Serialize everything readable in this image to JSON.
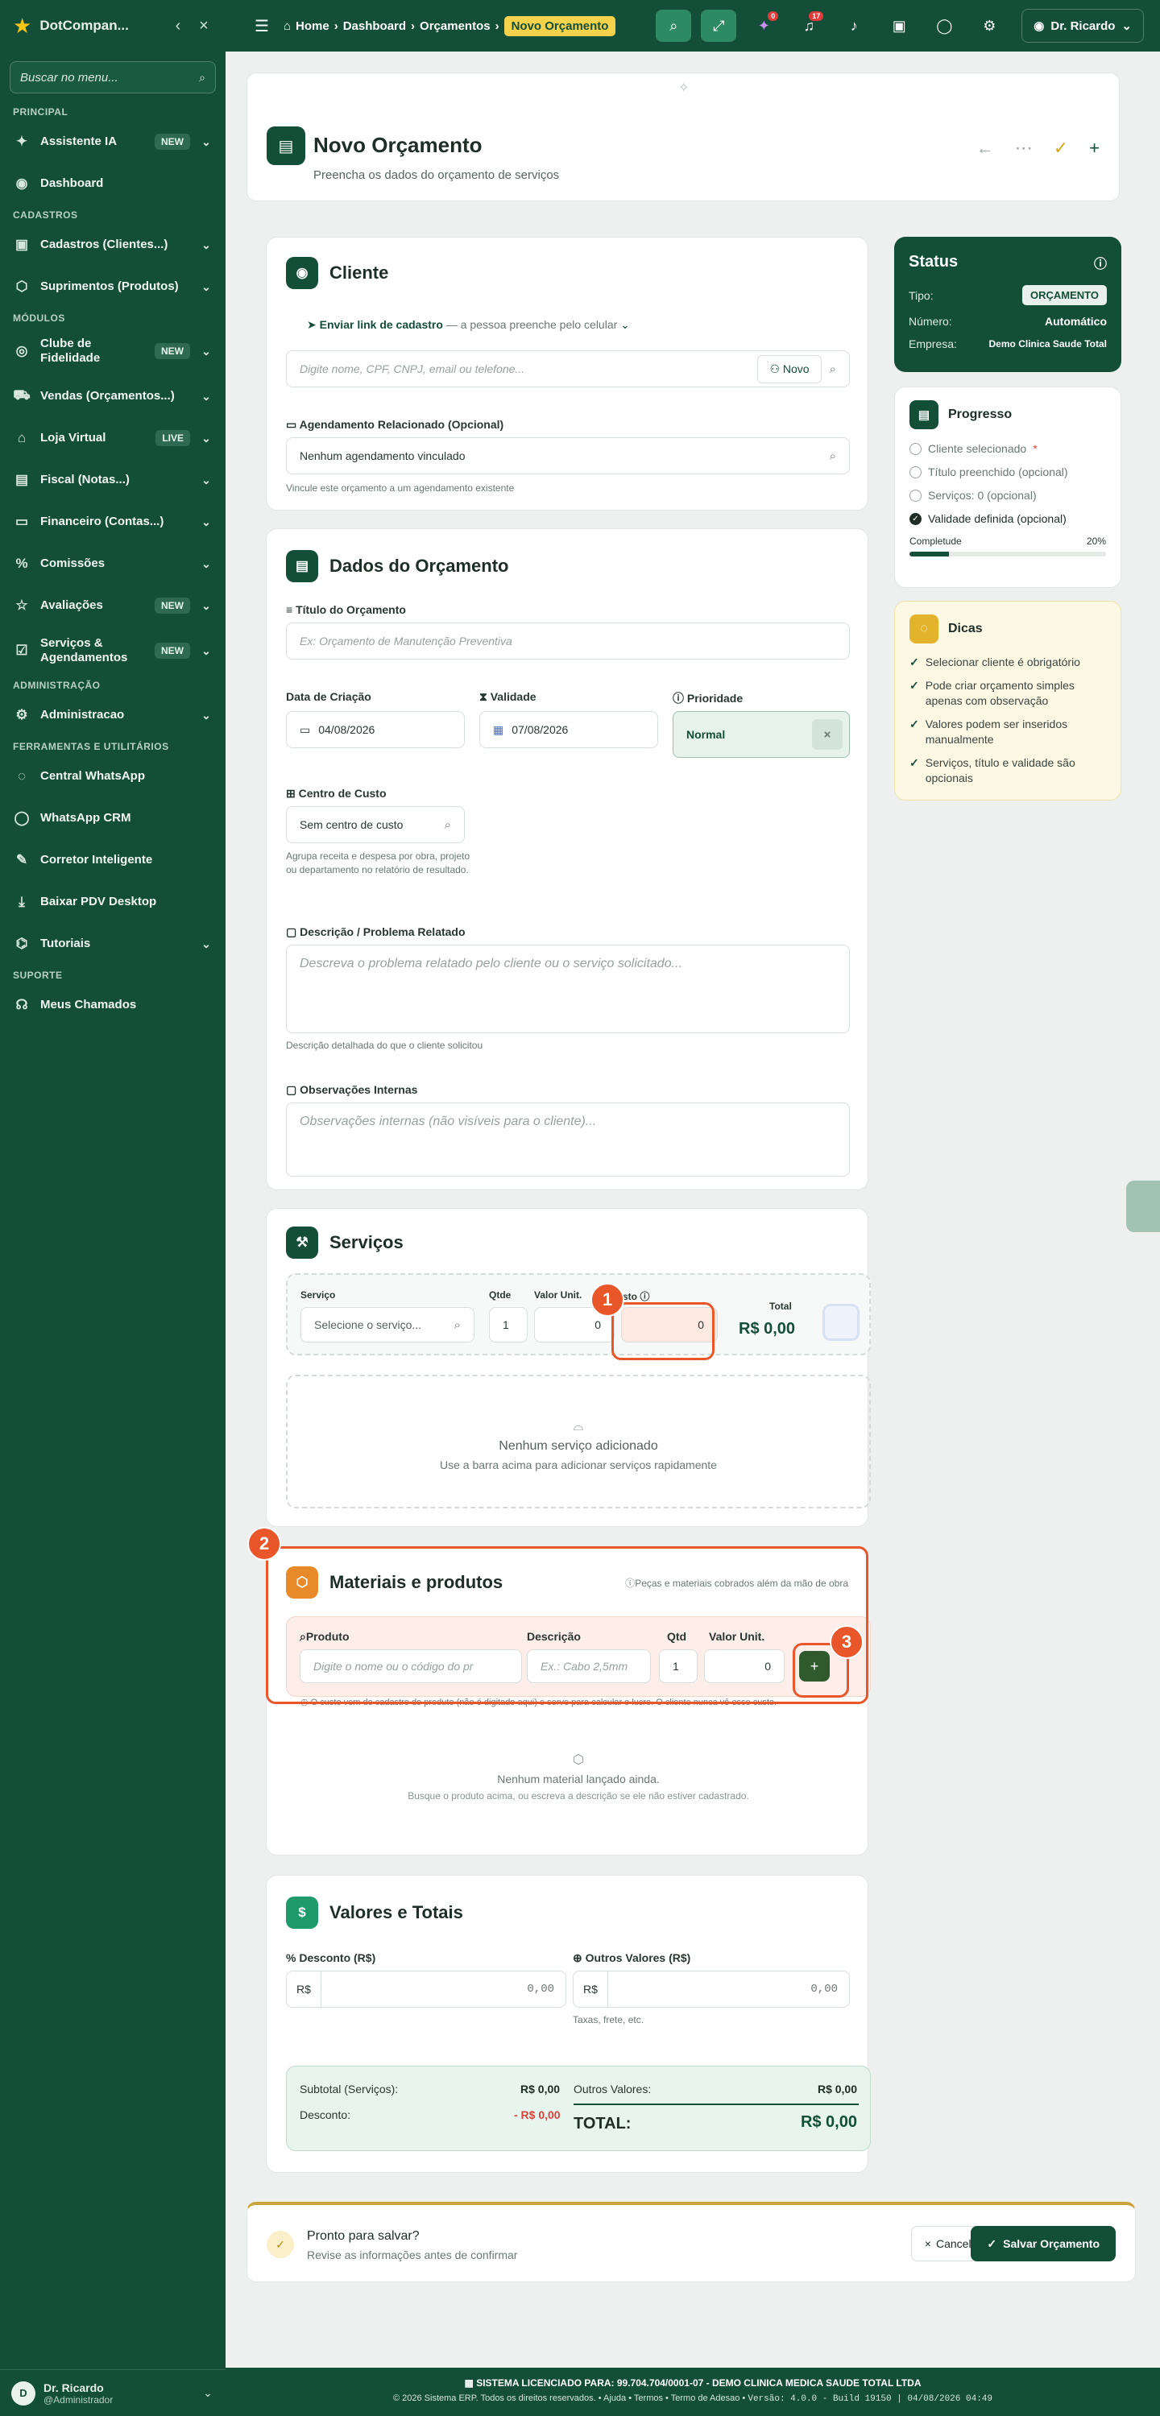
{
  "sidebar": {
    "brand": "DotCompan...",
    "search_placeholder": "Buscar no menu...",
    "sections": {
      "principal": "PRINCIPAL",
      "cadastros": "CADASTROS",
      "modulos": "MÓDULOS",
      "administracao": "ADMINISTRAÇÃO",
      "ferramentas": "FERRAMENTAS E UTILITÁRIOS",
      "suporte": "SUPORTE"
    },
    "items": {
      "assistente": {
        "label": "Assistente IA",
        "badge": "NEW"
      },
      "dashboard": {
        "label": "Dashboard"
      },
      "cadastros": {
        "label": "Cadastros (Clientes...)"
      },
      "suprimentos": {
        "label": "Suprimentos (Produtos)"
      },
      "fidelidade": {
        "label": "Clube de Fidelidade",
        "badge": "NEW"
      },
      "vendas": {
        "label": "Vendas (Orçamentos...)"
      },
      "loja": {
        "label": "Loja Virtual",
        "badge": "LIVE"
      },
      "fiscal": {
        "label": "Fiscal (Notas...)"
      },
      "financeiro": {
        "label": "Financeiro (Contas...)"
      },
      "comissoes": {
        "label": "Comissões"
      },
      "avaliacoes": {
        "label": "Avaliações",
        "badge": "NEW"
      },
      "servicos": {
        "label": "Serviços & Agendamentos",
        "badge": "NEW"
      },
      "admin": {
        "label": "Administracao"
      },
      "whatsapp": {
        "label": "Central WhatsApp"
      },
      "crm": {
        "label": "WhatsApp CRM"
      },
      "corretor": {
        "label": "Corretor Inteligente"
      },
      "pdv": {
        "label": "Baixar PDV Desktop"
      },
      "tutoriais": {
        "label": "Tutoriais"
      },
      "chamados": {
        "label": "Meus Chamados"
      }
    },
    "user": {
      "initial": "D",
      "name": "Dr. Ricardo",
      "role": "@Administrador"
    }
  },
  "topbar": {
    "breadcrumb": {
      "home": "Home",
      "dashboard": "Dashboard",
      "orcamentos": "Orçamentos",
      "current": "Novo Orçamento"
    },
    "notif_ai": "0",
    "notif_bell": "17",
    "user": "Dr. Ricardo"
  },
  "header": {
    "title": "Novo Orçamento",
    "subtitle": "Preencha os dados do orçamento de serviços"
  },
  "cliente": {
    "title": "Cliente",
    "link_label": "Enviar link de cadastro",
    "link_hint": "— a pessoa preenche pelo celular",
    "search_placeholder": "Digite nome, CPF, CNPJ, email ou telefone...",
    "novo_label": "Novo",
    "agendamento_label": "Agendamento Relacionado (Opcional)",
    "agendamento_value": "Nenhum agendamento vinculado",
    "agendamento_hint": "Vincule este orçamento a um agendamento existente"
  },
  "dados": {
    "title": "Dados do Orçamento",
    "titulo_label": "Título do Orçamento",
    "titulo_placeholder": "Ex: Orçamento de Manutenção Preventiva",
    "data_label": "Data de Criação",
    "data_value": "04/08/2026",
    "validade_label": "Validade",
    "validade_value": "07/08/2026",
    "prioridade_label": "Prioridade",
    "prioridade_value": "Normal",
    "centro_label": "Centro de Custo",
    "centro_value": "Sem centro de custo",
    "centro_hint": "Agrupa receita e despesa por obra, projeto ou departamento no relatório de resultado.",
    "descricao_label": "Descrição / Problema Relatado",
    "descricao_placeholder": "Descreva o problema relatado pelo cliente ou o serviço solicitado...",
    "descricao_hint": "Descrição detalhada do que o cliente solicitou",
    "obs_label": "Observações Internas",
    "obs_placeholder": "Observações internas (não visíveis para o cliente)..."
  },
  "servicos": {
    "title": "Serviços",
    "col_servico": "Serviço",
    "servico_placeholder": "Selecione o serviço...",
    "col_qtde": "Qtde",
    "qtde_value": "1",
    "col_valor": "Valor Unit.",
    "valor_value": "0",
    "col_custo": "sto",
    "custo_value": "0",
    "col_total": "Total",
    "total_value": "R$ 0,00",
    "empty_title": "Nenhum serviço adicionado",
    "empty_sub": "Use a barra acima para adicionar serviços rapidamente"
  },
  "materiais": {
    "title": "Materiais e produtos",
    "hint": "Peças e materiais cobrados além da mão de obra",
    "col_produto": "Produto",
    "produto_placeholder": "Digite o nome ou o código do pr",
    "col_descricao": "Descrição",
    "descricao_placeholder": "Ex.: Cabo 2,5mm",
    "col_qtd": "Qtd",
    "qtd_value": "1",
    "col_valor": "Valor Unit.",
    "valor_value": "0",
    "note": "O custo vem do cadastro do produto (não é digitado aqui) e serve para calcular o lucro. O cliente nunca vê esse custo.",
    "empty_title": "Nenhum material lançado ainda.",
    "empty_sub": "Busque o produto acima, ou escreva a descrição se ele não estiver cadastrado."
  },
  "valores": {
    "title": "Valores e Totais",
    "desconto_label": "Desconto (R$)",
    "outros_label": "Outros Valores (R$)",
    "currency": "R$",
    "desconto_value": "0,00",
    "outros_value": "0,00",
    "outros_hint": "Taxas, frete, etc.",
    "subtotal_label": "Subtotal (Serviços):",
    "subtotal_value": "R$ 0,00",
    "desconto_row_label": "Desconto:",
    "desconto_row_value": "- R$ 0,00",
    "outros_row_label": "Outros Valores:",
    "outros_row_value": "R$ 0,00",
    "total_label": "TOTAL:",
    "total_value": "R$ 0,00"
  },
  "status": {
    "title": "Status",
    "tipo_label": "Tipo:",
    "tipo_value": "ORÇAMENTO",
    "numero_label": "Número:",
    "numero_value": "Automático",
    "empresa_label": "Empresa:",
    "empresa_value": "Demo Clinica Saude Total"
  },
  "progresso": {
    "title": "Progresso",
    "items": [
      "Cliente selecionado",
      "Título preenchido (opcional)",
      "Serviços: 0 (opcional)",
      "Validade definida (opcional)"
    ],
    "required_mark": "*",
    "completude_label": "Completude",
    "completude_value": "20%",
    "completude_fraction": 0.2
  },
  "dicas": {
    "title": "Dicas",
    "items": [
      "Selecionar cliente é obrigatório",
      "Pode criar orçamento simples apenas com observação",
      "Valores podem ser inseridos manualmente",
      "Serviços, título e validade são opcionais"
    ]
  },
  "footer": {
    "title": "Pronto para salvar?",
    "subtitle": "Revise as informações antes de confirmar",
    "cancel": "Cancelar",
    "save": "Salvar Orçamento"
  },
  "callouts": [
    "1",
    "2",
    "3"
  ],
  "license": {
    "line1": "SISTEMA LICENCIADO PARA: 99.704.704/0001-07 - DEMO CLINICA MEDICA SAUDE TOTAL LTDA",
    "copyright": "© 2026 Sistema ERP. Todos os direitos reservados.",
    "ajuda": "Ajuda",
    "termos": "Termos",
    "adesao": "Termo de Adesao",
    "versao": "Versão: 4.0.0 - Build 19150 | 04/08/2026 04:49"
  }
}
